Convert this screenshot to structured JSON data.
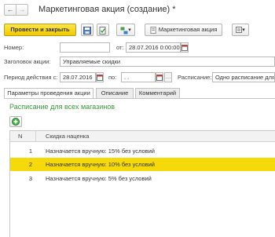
{
  "window": {
    "title": "Маркетинговая акция (создание) *",
    "back_glyph": "←",
    "forward_glyph": "→"
  },
  "toolbar": {
    "post_and_close_label": "Провести и закрыть",
    "marketing_action_label": "Маркетинговая акция",
    "dropdown_glyph": "▾",
    "more_glyph": "▾"
  },
  "form": {
    "number_label": "Номер:",
    "number_value": "",
    "from_label": "от:",
    "from_value": "28.07.2016  0:00:00",
    "header_label": "Заголовок акции:",
    "header_value": "Управляемые скидки",
    "period_label": "Период действия с:",
    "period_from_value": "28.07.2016",
    "period_to_label": "по:",
    "period_to_value": " .  .",
    "schedule_label": "Расписание:",
    "schedule_value": "Одно расписание для"
  },
  "tabs": [
    {
      "label": "Параметры проведения акции",
      "active": true
    },
    {
      "label": "Описание",
      "active": false
    },
    {
      "label": "Комментарий",
      "active": false
    }
  ],
  "section": {
    "title": "Расписание для всех магазинов"
  },
  "table": {
    "columns": [
      "N",
      "Скидка наценка"
    ],
    "rows": [
      {
        "n": "1",
        "text": "Назначается вручную: 15% без условий",
        "selected": false
      },
      {
        "n": "2",
        "text": "Назначается вручную: 10% без условий",
        "selected": true
      },
      {
        "n": "3",
        "text": "Назначается вручную: 5% без условий",
        "selected": false
      }
    ]
  },
  "colors": {
    "primary_button": "#f1c900",
    "selected_row": "#f5d90a",
    "section_title": "#3b9a3b"
  }
}
